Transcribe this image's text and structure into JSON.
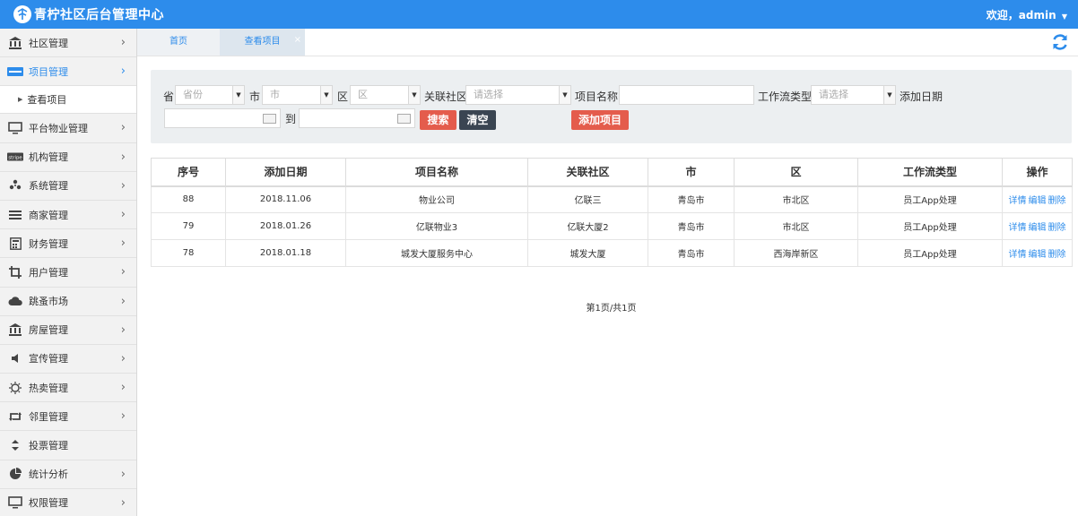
{
  "header": {
    "title": "青柠社区后台管理中心",
    "welcome": "欢迎，admin",
    "dropdown_icon": "chevron-down-icon",
    "brand_color": "#2d8ceb"
  },
  "sidebar": {
    "items": [
      {
        "label": "社区管理",
        "icon": "bank-icon"
      },
      {
        "label": "项目管理",
        "icon": "card-icon",
        "active": true,
        "sub": [
          {
            "label": "查看项目"
          }
        ]
      },
      {
        "label": "平台物业管理",
        "icon": "monitor-icon"
      },
      {
        "label": "机构管理",
        "icon": "stripe-icon"
      },
      {
        "label": "系统管理",
        "icon": "pinwheel-icon"
      },
      {
        "label": "商家管理",
        "icon": "bars-icon"
      },
      {
        "label": "财务管理",
        "icon": "calculator-icon"
      },
      {
        "label": "用户管理",
        "icon": "crop-icon"
      },
      {
        "label": "跳蚤市场",
        "icon": "cloud-icon"
      },
      {
        "label": "房屋管理",
        "icon": "bank-icon"
      },
      {
        "label": "宣传管理",
        "icon": "speaker-icon"
      },
      {
        "label": "热卖管理",
        "icon": "sun-icon"
      },
      {
        "label": "邻里管理",
        "icon": "retweet-icon"
      },
      {
        "label": "投票管理",
        "icon": "sort-icon"
      },
      {
        "label": "统计分析",
        "icon": "pie-chart-icon"
      },
      {
        "label": "权限管理",
        "icon": "monitor-icon"
      }
    ]
  },
  "tabs": [
    {
      "label": "首页"
    },
    {
      "label": "查看项目",
      "close": "×"
    }
  ],
  "filter": {
    "province_label": "省",
    "province_placeholder": "省份",
    "city_label": "市",
    "city_placeholder": "市",
    "district_label": "区",
    "district_placeholder": "区",
    "community_label": "关联社区",
    "community_placeholder": "请选择",
    "project_name_label": "项目名称",
    "workflow_label": "工作流类型",
    "workflow_placeholder": "请选择",
    "add_date_label": "添加日期",
    "to_label": "到",
    "search_btn": "搜索",
    "clear_btn": "清空",
    "add_btn": "添加项目"
  },
  "table": {
    "columns": [
      "序号",
      "添加日期",
      "项目名称",
      "关联社区",
      "市",
      "区",
      "工作流类型",
      "操作"
    ],
    "rows": [
      {
        "id": "88",
        "date": "2018.11.06",
        "name": "物业公司",
        "community": "亿联三",
        "city": "青岛市",
        "district": "市北区",
        "workflow": "员工App处理"
      },
      {
        "id": "79",
        "date": "2018.01.26",
        "name": "亿联物业3",
        "community": "亿联大厦2",
        "city": "青岛市",
        "district": "市北区",
        "workflow": "员工App处理"
      },
      {
        "id": "78",
        "date": "2018.01.18",
        "name": "城发大厦服务中心",
        "community": "城发大厦",
        "city": "青岛市",
        "district": "西海岸新区",
        "workflow": "员工App处理"
      }
    ],
    "ops": [
      "详情",
      "编辑",
      "删除"
    ]
  },
  "pager": "第1页/共1页"
}
